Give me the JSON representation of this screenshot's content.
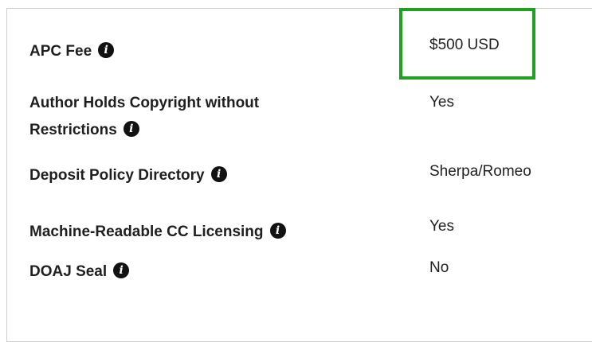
{
  "rows": [
    {
      "label": "APC Fee",
      "value": "$500 USD",
      "info_icon": "info-icon"
    },
    {
      "label": "Author Holds Copyright without",
      "label_line2": "Restrictions",
      "value": "Yes",
      "info_icon": "info-icon"
    },
    {
      "label": "Deposit Policy Directory",
      "value": "Sherpa/Romeo",
      "info_icon": "info-icon"
    },
    {
      "label": "Machine-Readable CC Licensing",
      "value": "Yes",
      "info_icon": "info-icon"
    },
    {
      "label": "DOAJ Seal",
      "value": "No",
      "info_icon": "info-icon"
    }
  ],
  "info_glyph": "i",
  "highlight_color": "#20a020"
}
